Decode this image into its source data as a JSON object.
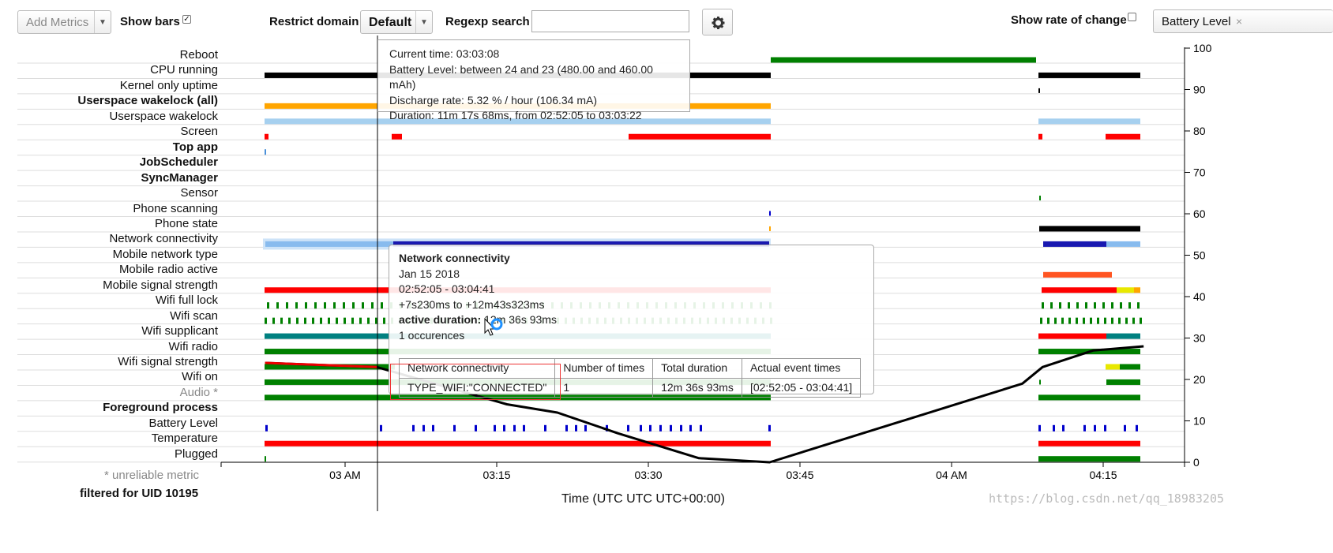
{
  "toolbar": {
    "add_metrics": "Add Metrics",
    "show_bars": "Show bars",
    "show_bars_checked": "✓",
    "restrict_domain": "Restrict domain",
    "domain_value": "Default",
    "regexp_search": "Regexp search",
    "regexp_value": "",
    "show_rate_of_change": "Show rate of change",
    "battery_level_select": "Battery Level"
  },
  "rows": [
    {
      "label": "Reboot",
      "bold": false
    },
    {
      "label": "CPU running",
      "bold": false
    },
    {
      "label": "Kernel only uptime",
      "bold": false
    },
    {
      "label": "Userspace wakelock (all)",
      "bold": true
    },
    {
      "label": "Userspace wakelock",
      "bold": false
    },
    {
      "label": "Screen",
      "bold": false
    },
    {
      "label": "Top app",
      "bold": true
    },
    {
      "label": "JobScheduler",
      "bold": true
    },
    {
      "label": "SyncManager",
      "bold": true
    },
    {
      "label": "Sensor",
      "bold": false
    },
    {
      "label": "Phone scanning",
      "bold": false
    },
    {
      "label": "Phone state",
      "bold": false
    },
    {
      "label": "Network connectivity",
      "bold": false
    },
    {
      "label": "Mobile network type",
      "bold": false
    },
    {
      "label": "Mobile radio active",
      "bold": false
    },
    {
      "label": "Mobile signal strength",
      "bold": false
    },
    {
      "label": "Wifi full lock",
      "bold": false
    },
    {
      "label": "Wifi scan",
      "bold": false
    },
    {
      "label": "Wifi supplicant",
      "bold": false
    },
    {
      "label": "Wifi radio",
      "bold": false
    },
    {
      "label": "Wifi signal strength",
      "bold": false
    },
    {
      "label": "Wifi on",
      "bold": false
    },
    {
      "label": "Audio *",
      "bold": false,
      "grey": true
    },
    {
      "label": "Foreground process",
      "bold": true
    },
    {
      "label": "Battery Level",
      "bold": false
    },
    {
      "label": "Temperature",
      "bold": false
    },
    {
      "label": "Plugged",
      "bold": false
    }
  ],
  "x_axis": {
    "ticks": [
      "03 AM",
      "03:15",
      "03:30",
      "03:45",
      "04 AM",
      "04:15"
    ],
    "title": "Time (UTC UTC UTC+00:00)"
  },
  "y_axis": {
    "ticks": [
      "100",
      "90",
      "80",
      "70",
      "60",
      "50",
      "40",
      "30",
      "20",
      "10",
      "0"
    ]
  },
  "footer": {
    "unreliable": "* unreliable metric",
    "filtered": "filtered for UID 10195"
  },
  "tooltip_battery": {
    "current_time": "Current time: 03:03:08",
    "battery_level": "Battery Level: between 24 and 23 (480.00 and 460.00 mAh)",
    "discharge_rate": "Discharge rate: 5.32 % / hour (106.34 mA)",
    "duration": "Duration: 11m 17s 68ms, from 02:52:05 to 03:03:22"
  },
  "tooltip_network": {
    "title": "Network connectivity",
    "date": "Jan 15 2018",
    "range": "02:52:05 - 03:04:41",
    "offset": "+7s230ms to +12m43s323ms",
    "active_label": "active duration:",
    "active_value": "12m 36s 93ms",
    "occurrences": "1 occurences",
    "table_headers": [
      "Network connectivity",
      "Number of times",
      "Total duration",
      "Actual event times"
    ],
    "table_row": [
      "TYPE_WIFI:\"CONNECTED\"",
      "1",
      "12m 36s 93ms",
      "[02:52:05 - 03:04:41]"
    ]
  },
  "watermark": "https://blog.csdn.net/qq_18983205",
  "colors": {
    "green": "#008000",
    "black": "#000000",
    "orange": "#ffa500",
    "lightblue": "#a6d0ef",
    "red": "#ff0000",
    "blue": "#0000cc",
    "teal": "#008080"
  },
  "chart_data": {
    "type": "line",
    "series": [
      {
        "name": "Battery Level",
        "x": [
          "02:52:05",
          "03:03:08",
          "03:16",
          "03:21",
          "03:27",
          "03:35",
          "03:42",
          "04:07",
          "04:09",
          "04:14",
          "04:19"
        ],
        "values": [
          24,
          23,
          14,
          12,
          7,
          1,
          0,
          19,
          23,
          27,
          28
        ]
      }
    ],
    "ylim": [
      0,
      100
    ]
  }
}
